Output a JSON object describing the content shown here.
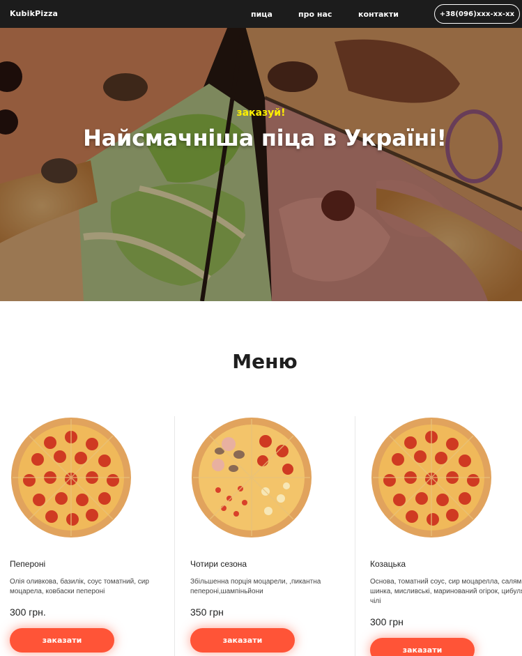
{
  "header": {
    "logo": "KubikPizza",
    "nav": [
      "пица",
      "про нас",
      "контакти"
    ],
    "phone": "+38(096)xxx-xx-xx"
  },
  "hero": {
    "tag": "заказуй!",
    "title": "Найсмачніша піца в Україні!"
  },
  "menu": {
    "title": "Меню",
    "items": [
      {
        "name": "Пепероні",
        "description": "Олія оливкова, базилік, соус томатний, сир моцарела, ковбаски пепероні",
        "price": "300 грн.",
        "button": "заказати"
      },
      {
        "name": "Чотири сезона",
        "description": "Збільшенна порція моцарели, ,пикантна пепероні,шампіньйони",
        "price": "350 грн",
        "button": "заказати"
      },
      {
        "name": "Козацька",
        "description": "Основа, томатний соус, сир моцарелла, салямі, шинка, мисливські, маринований огірок, цибуля, чілі",
        "price": "300 грн",
        "button": "заказати"
      }
    ]
  },
  "colors": {
    "header_bg": "#1c1c1c",
    "accent": "#ff5437",
    "hero_tag": "#fff200"
  }
}
